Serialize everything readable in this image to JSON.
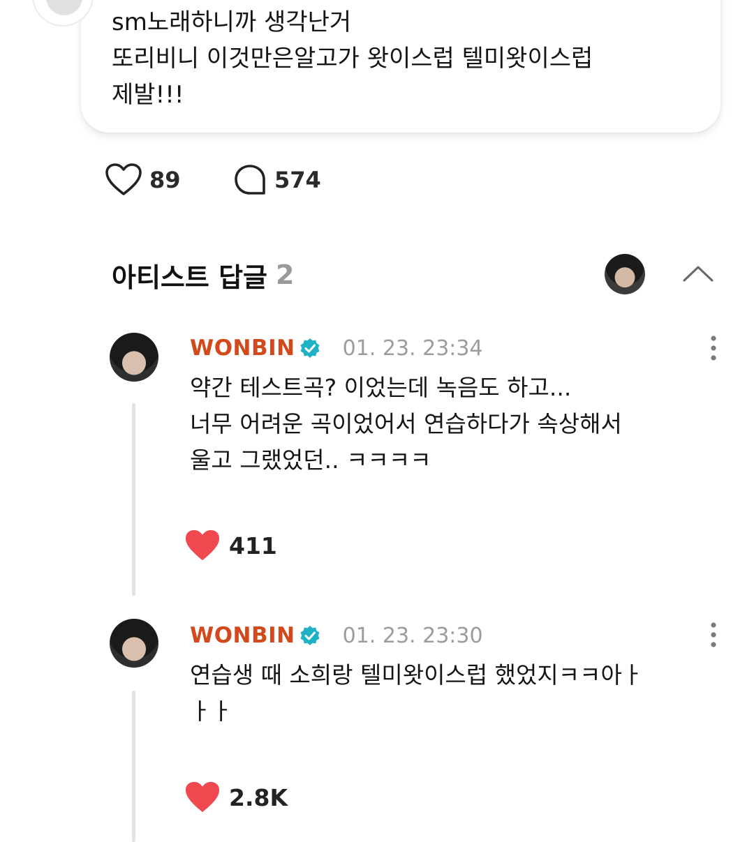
{
  "post": {
    "lines": [
      "sm노래하니까 생각난거",
      "또리비니 이것만은알고가 왓이스럽 텔미왓이스럽",
      "제발!!!"
    ],
    "like_count": "89",
    "comment_count": "574"
  },
  "artist_replies": {
    "title": "아티스트 답글",
    "count": "2",
    "items": [
      {
        "author": "WONBIN",
        "timestamp": "01. 23. 23:34",
        "lines": [
          "약간 테스트곡? 이었는데 녹음도 하고...",
          "너무 어려운 곡이었어서 연습하다가 속상해서",
          "울고 그랬었던.. ㅋㅋㅋㅋ"
        ],
        "likes": "411"
      },
      {
        "author": "WONBIN",
        "timestamp": "01. 23. 23:30",
        "lines": [
          "연습생 때 소희랑 텔미왓이스럽 했었지ㅋㅋ아ㅏ",
          "ㅏㅏ"
        ],
        "likes": "2.8K"
      }
    ]
  },
  "colors": {
    "author": "#d2491c",
    "verified": "#1fb2c4",
    "heart_filled": "#f0484f",
    "muted": "#9c9c9c"
  },
  "icons": [
    "heart-outline-icon",
    "comment-bubble-icon",
    "chevron-up-icon",
    "verified-badge-icon",
    "more-vertical-icon",
    "heart-filled-icon"
  ]
}
